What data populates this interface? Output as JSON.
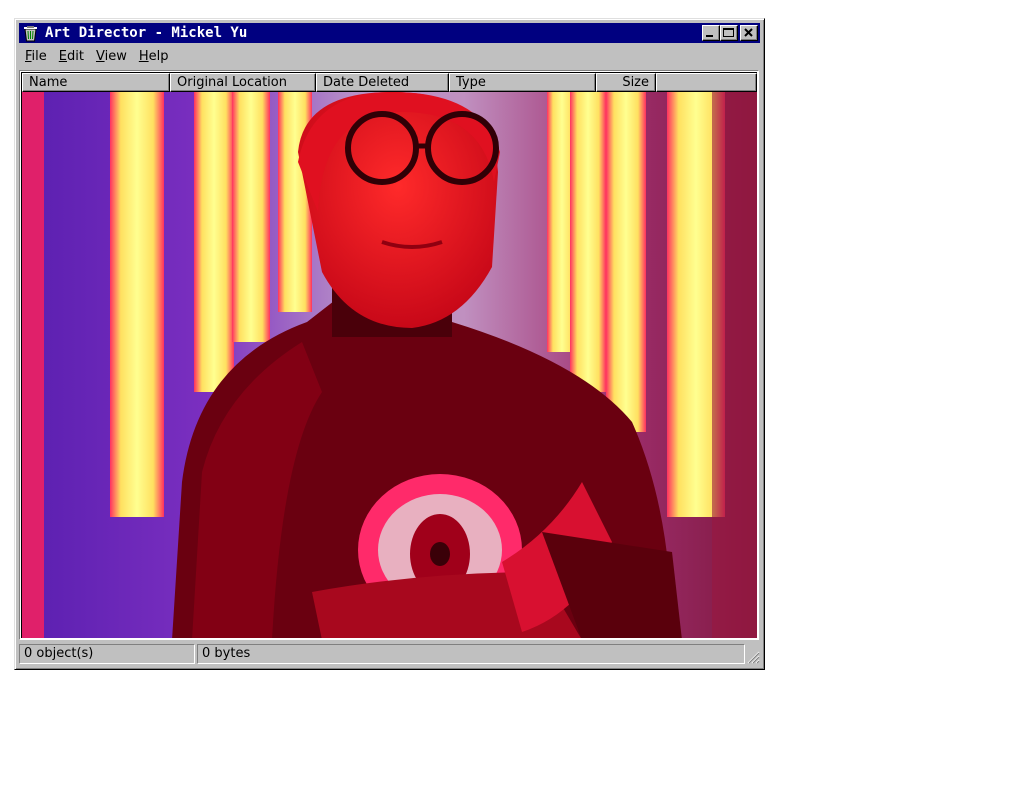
{
  "window": {
    "title": "Art Director - Mickel Yu",
    "buttons": {
      "minimize": "minimize-button",
      "maximize": "maximize-button",
      "close": "close-button"
    }
  },
  "menu": {
    "items": [
      {
        "label": "ile",
        "accel": "F"
      },
      {
        "label": "dit",
        "accel": "E"
      },
      {
        "label": "iew",
        "accel": "V"
      },
      {
        "label": "elp",
        "accel": "H"
      }
    ]
  },
  "columns": [
    "Name",
    "Original Location",
    "Date Deleted",
    "Type",
    "Size"
  ],
  "status": {
    "objects": "0 object(s)",
    "bytes": "0 bytes"
  },
  "icons": {
    "app": "recycle-bin-icon",
    "grip": "resize-grip-icon"
  },
  "colors": {
    "titlebar": "#000080",
    "chrome": "#c0c0c0",
    "photo_tint": "#d0102a"
  }
}
